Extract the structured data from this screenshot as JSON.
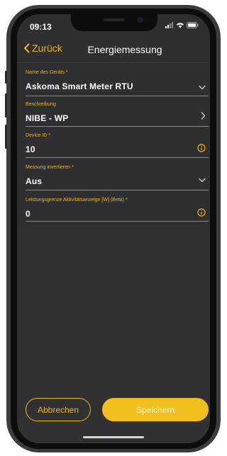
{
  "status_bar": {
    "time": "09:13"
  },
  "nav": {
    "back_label": "Zurück",
    "title": "Energiemessung"
  },
  "fields": [
    {
      "label": "Name des Geräts *",
      "value": "Askoma Smart Meter RTU",
      "icon": "chevron-down-icon"
    },
    {
      "label": "Beschreibung",
      "value": "NIBE - WP",
      "icon": "chevron-right-icon"
    },
    {
      "label": "Device ID *",
      "value": "10",
      "icon": "info-icon"
    },
    {
      "label": "Messung invertieren *",
      "value": "Aus",
      "icon": "chevron-down-icon"
    },
    {
      "label": "Leistungsgrenze Aktivitätsanzeige [W] (Beta) *",
      "value": "0",
      "icon": "info-icon"
    }
  ],
  "actions": {
    "cancel_label": "Abbrechen",
    "save_label": "Speichern"
  },
  "colors": {
    "accent": "#e8b81f",
    "background": "#2f2f31",
    "save_button": "#f1bf1e"
  }
}
